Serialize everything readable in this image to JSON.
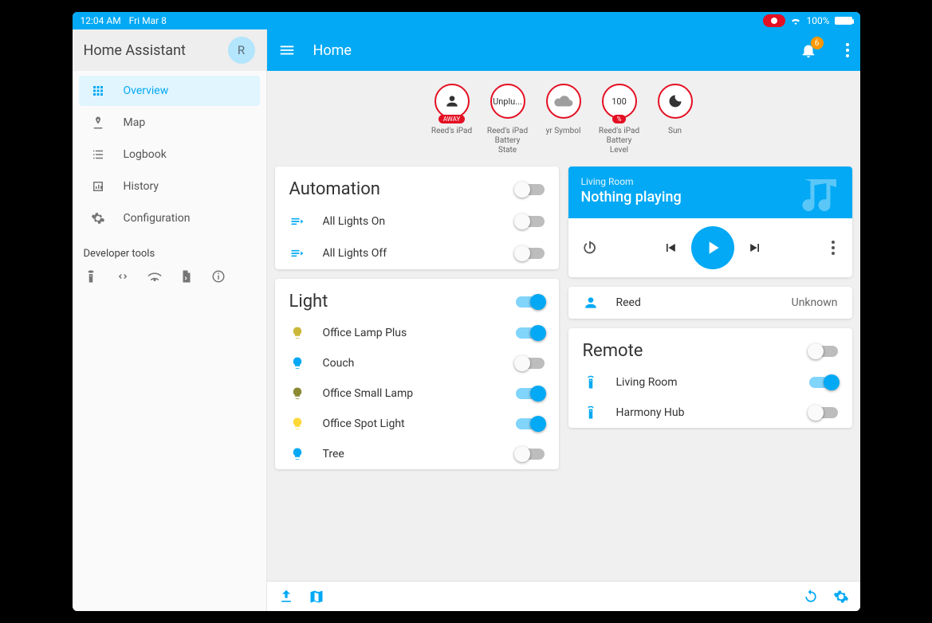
{
  "statusbar": {
    "time": "12:04 AM",
    "date": "Fri Mar 8",
    "battery": "100%"
  },
  "sidebar": {
    "title": "Home Assistant",
    "avatar": "R",
    "items": [
      {
        "icon": "grid",
        "label": "Overview",
        "active": true
      },
      {
        "icon": "map-pin",
        "label": "Map"
      },
      {
        "icon": "list",
        "label": "Logbook"
      },
      {
        "icon": "chart",
        "label": "History"
      },
      {
        "icon": "gear",
        "label": "Configuration"
      }
    ],
    "dev_label": "Developer tools",
    "dev_icons": [
      "remote",
      "code",
      "broadcast",
      "file",
      "info"
    ]
  },
  "topbar": {
    "title": "Home",
    "notif_count": "6"
  },
  "badges": [
    {
      "icon": "person",
      "tag": "AWAY",
      "label": "Reed's iPad"
    },
    {
      "text": "Unplu...",
      "label": "Reed's iPad Battery State"
    },
    {
      "icon": "cloud",
      "label": "yr Symbol"
    },
    {
      "text": "100",
      "tag": "%",
      "label": "Reed's iPad Battery Level"
    },
    {
      "icon": "moon",
      "label": "Sun"
    }
  ],
  "cards": {
    "automation": {
      "title": "Automation",
      "header_toggle": false,
      "rows": [
        {
          "icon": "flow",
          "label": "All Lights On",
          "on": false
        },
        {
          "icon": "flow",
          "label": "All Lights Off",
          "on": false
        }
      ]
    },
    "light": {
      "title": "Light",
      "header_toggle": true,
      "rows": [
        {
          "color": "#cbb839",
          "label": "Office Lamp Plus",
          "on": true
        },
        {
          "color": "#03a9f4",
          "label": "Couch",
          "on": false
        },
        {
          "color": "#8b8a33",
          "label": "Office Small Lamp",
          "on": true
        },
        {
          "color": "#fdd835",
          "label": "Office Spot Light",
          "on": true
        },
        {
          "color": "#03a9f4",
          "label": "Tree",
          "on": false
        }
      ]
    },
    "media": {
      "room": "Living Room",
      "status": "Nothing playing"
    },
    "person": {
      "name": "Reed",
      "state": "Unknown"
    },
    "remote": {
      "title": "Remote",
      "header_toggle": false,
      "rows": [
        {
          "label": "Living Room",
          "on": true
        },
        {
          "label": "Harmony Hub",
          "on": false
        }
      ]
    }
  }
}
